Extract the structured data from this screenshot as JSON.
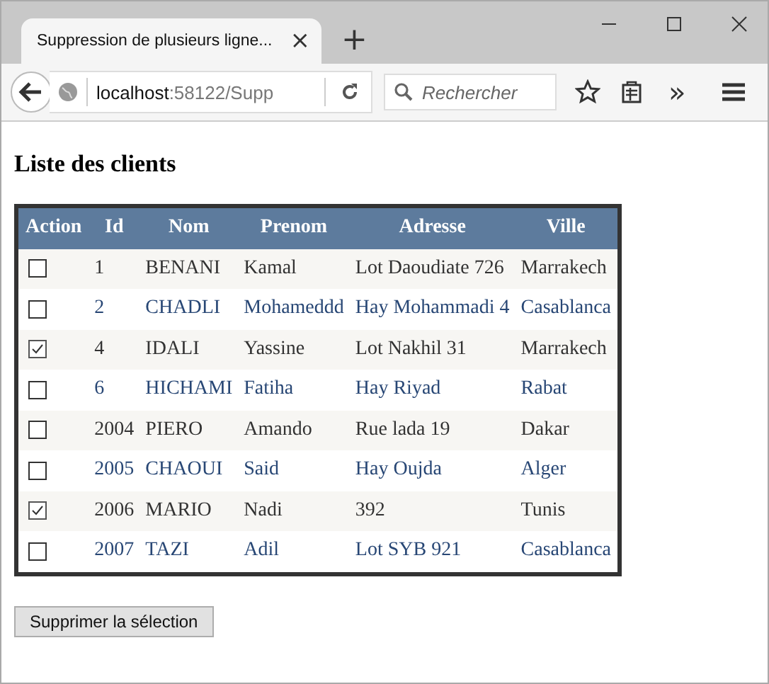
{
  "browser": {
    "tab_title": "Suppression de plusieurs ligne...",
    "tab_close": "×",
    "new_tab": "+",
    "address_host": "localhost",
    "address_rest": ":58122/Supp",
    "search_placeholder": "Rechercher",
    "overflow": "»"
  },
  "page": {
    "heading": "Liste des clients",
    "table": {
      "action_header": "Action",
      "columns": [
        "Id",
        "Nom",
        "Prenom",
        "Adresse",
        "Ville"
      ],
      "rows": [
        {
          "checked": false,
          "cells": [
            "1",
            "BENANI",
            "Kamal",
            "Lot Daoudiate 726",
            "Marrakech"
          ]
        },
        {
          "checked": false,
          "cells": [
            "2",
            "CHADLI",
            "Mohameddd",
            "Hay Mohammadi 4",
            "Casablanca"
          ]
        },
        {
          "checked": true,
          "cells": [
            "4",
            "IDALI",
            "Yassine",
            "Lot Nakhil 31",
            "Marrakech"
          ]
        },
        {
          "checked": false,
          "cells": [
            "6",
            "HICHAMI",
            "Fatiha",
            "Hay Riyad",
            "Rabat"
          ]
        },
        {
          "checked": false,
          "cells": [
            "2004",
            "PIERO",
            "Amando",
            "Rue lada 19",
            "Dakar"
          ]
        },
        {
          "checked": false,
          "cells": [
            "2005",
            "CHAOUI",
            "Said",
            "Hay Oujda",
            "Alger"
          ]
        },
        {
          "checked": true,
          "cells": [
            "2006",
            "MARIO",
            "Nadi",
            "392",
            "Tunis"
          ]
        },
        {
          "checked": false,
          "cells": [
            "2007",
            "TAZI",
            "Adil",
            "Lot SYB 921",
            "Casablanca"
          ]
        }
      ]
    },
    "delete_button": "Supprimer la sélection"
  }
}
